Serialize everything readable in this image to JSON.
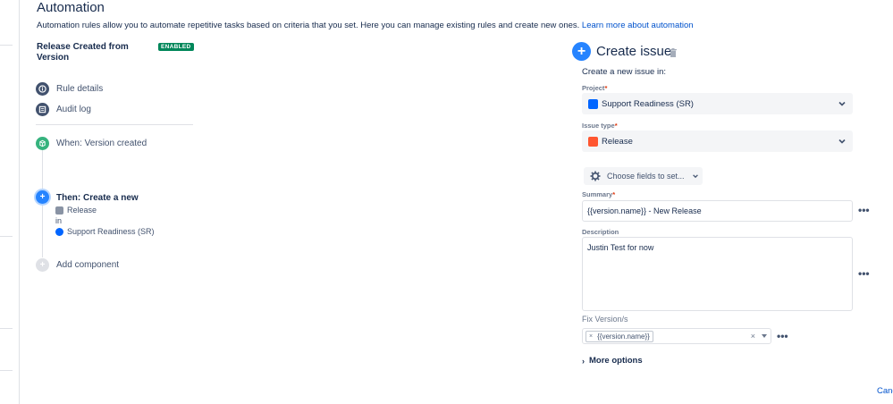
{
  "header": {
    "title": "Automation",
    "description": "Automation rules allow you to automate repetitive tasks based on criteria that you set. Here you can manage existing rules and create new ones.",
    "learn_more_link": "Learn more about automation"
  },
  "rule": {
    "title": "Release Created from Version",
    "status_badge": "ENABLED",
    "nav": [
      {
        "label": "Rule details",
        "icon": "info-icon"
      },
      {
        "label": "Audit log",
        "icon": "list-icon"
      }
    ],
    "trigger": {
      "label": "When: Version created",
      "icon": "version-icon"
    },
    "action": {
      "title": "Then: Create a new",
      "issue_type": "Release",
      "connector": "in",
      "project": "Support Readiness (SR)",
      "icon": "plus-icon"
    },
    "add_component": "Add component"
  },
  "create_issue": {
    "title": "Create issue",
    "subtitle": "Create a new issue in:",
    "project_label": "Project",
    "project_value": "Support Readiness (SR)",
    "issue_type_label": "Issue type",
    "issue_type_value": "Release",
    "choose_fields_button": "Choose fields to set...",
    "summary_label": "Summary",
    "summary_value": "{{version.name}} - New Release",
    "description_label": "Description",
    "description_value": "Justin Test for now",
    "fix_versions_label": "Fix Version/s",
    "fix_versions_tags": [
      "{{version.name}}"
    ],
    "more_options": "More options",
    "required_marker": "*"
  },
  "footer": {
    "cancel_label": "Cancel"
  },
  "colors": {
    "enabled_badge": "#00875a",
    "accent_blue": "#2684ff",
    "link": "#0052cc",
    "trigger_green": "#36b37e",
    "required": "#de350b"
  }
}
